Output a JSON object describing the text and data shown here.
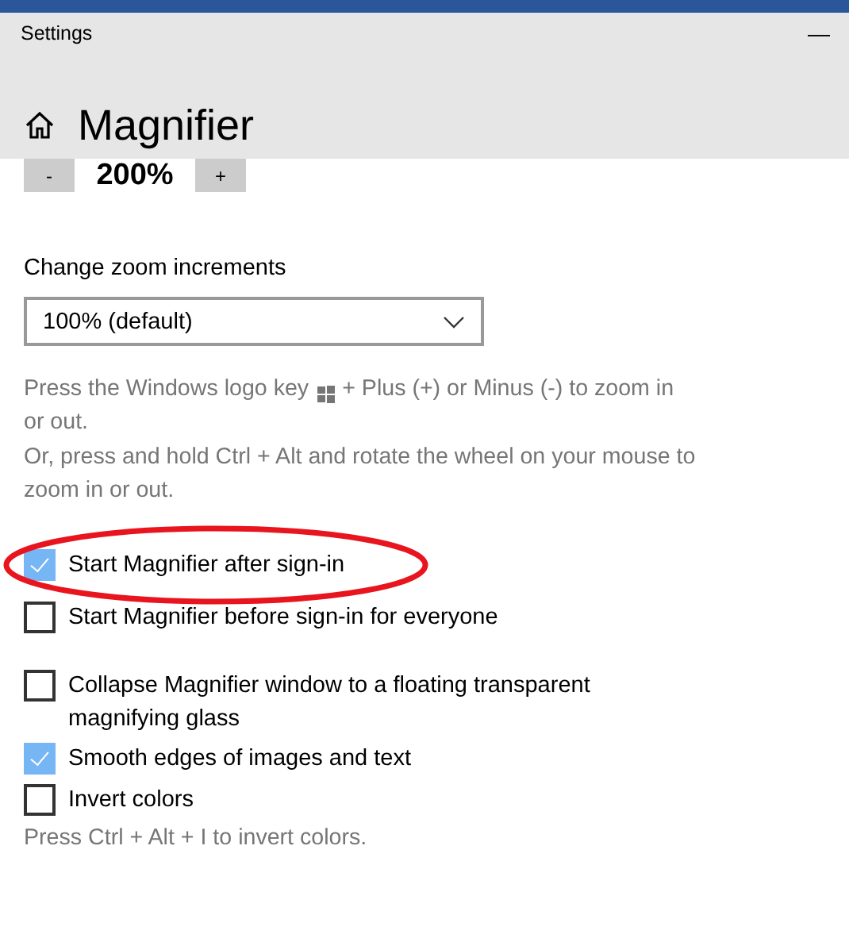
{
  "window": {
    "title": "Settings",
    "minimize": "—"
  },
  "page": {
    "title": "Magnifier"
  },
  "zoom": {
    "decrease": "-",
    "value": "200%",
    "increase": "+"
  },
  "increments": {
    "label": "Change zoom increments",
    "value": "100% (default)"
  },
  "help": [
    {
      "before_icon": "Press the Windows logo key",
      "after_icon": "+ Plus (+) or Minus (-) to zoom in",
      "continuation": "or out."
    },
    {
      "text": "Or, press and hold Ctrl + Alt and rotate the wheel on your mouse to zoom in or out."
    }
  ],
  "option_groups": [
    [
      {
        "label": "Start Magnifier after sign-in",
        "checked": true,
        "circled": true
      },
      {
        "label": "Start Magnifier before sign-in for everyone",
        "checked": false,
        "circled": false
      }
    ],
    [
      {
        "label": "Collapse Magnifier window to a floating transparent magnifying glass",
        "checked": false,
        "circled": false
      },
      {
        "label": "Smooth edges of images and text",
        "checked": true,
        "circled": false
      },
      {
        "label": "Invert colors",
        "checked": false,
        "circled": false
      }
    ]
  ],
  "footer": "Press Ctrl + Alt + I to invert colors."
}
